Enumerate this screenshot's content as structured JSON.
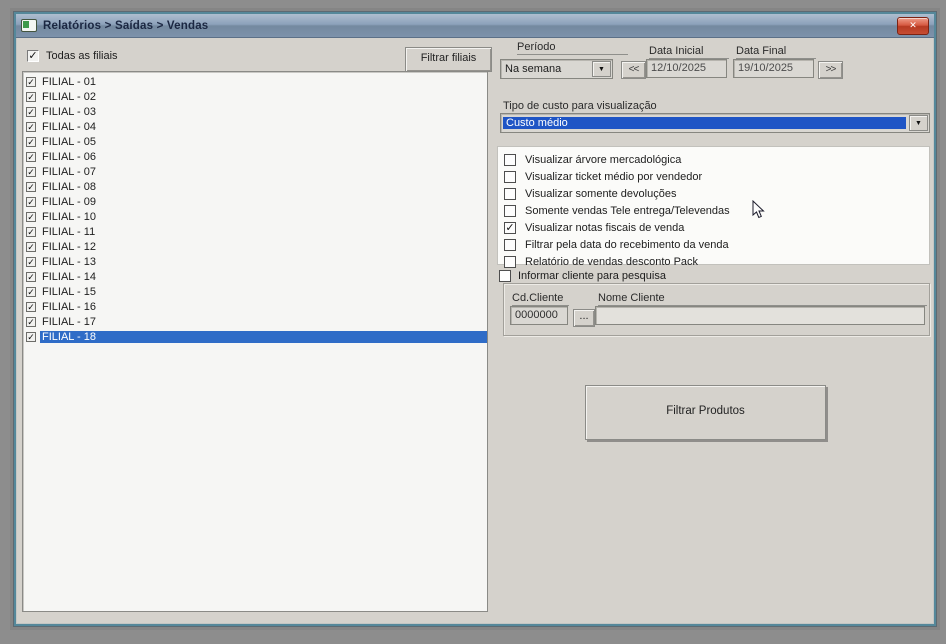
{
  "icons": {
    "check": "✓",
    "dropdown_arrow": "▼",
    "close": "✕"
  },
  "colors": {
    "selection_blue": "#2f6cc7",
    "combo_highlight_blue": "#1f55c5",
    "titlebar_blue": "#8ca1ba",
    "close_red": "#c64d33",
    "frame_teal": "#55889a",
    "window_gray": "#d5d2cc"
  },
  "window": {
    "title": "Relatórios > Saídas > Vendas"
  },
  "branches": {
    "all_label": "Todas as filiais",
    "all_checked": true,
    "filter_button": "Filtrar filiais",
    "selected_index": 17,
    "items": [
      {
        "label": "FILIAL - 01",
        "checked": true
      },
      {
        "label": "FILIAL - 02",
        "checked": true
      },
      {
        "label": "FILIAL - 03",
        "checked": true
      },
      {
        "label": "FILIAL - 04",
        "checked": true
      },
      {
        "label": "FILIAL - 05",
        "checked": true
      },
      {
        "label": "FILIAL - 06",
        "checked": true
      },
      {
        "label": "FILIAL - 07",
        "checked": true
      },
      {
        "label": "FILIAL - 08",
        "checked": true
      },
      {
        "label": "FILIAL - 09",
        "checked": true
      },
      {
        "label": "FILIAL - 10",
        "checked": true
      },
      {
        "label": "FILIAL - 11",
        "checked": true
      },
      {
        "label": "FILIAL - 12",
        "checked": true
      },
      {
        "label": "FILIAL - 13",
        "checked": true
      },
      {
        "label": "FILIAL - 14",
        "checked": true
      },
      {
        "label": "FILIAL - 15",
        "checked": true
      },
      {
        "label": "FILIAL - 16",
        "checked": true
      },
      {
        "label": "FILIAL - 17",
        "checked": true
      },
      {
        "label": "FILIAL - 18",
        "checked": true
      }
    ]
  },
  "period": {
    "label": "Período",
    "value": "Na semana",
    "prev_button": "<<",
    "next_button": ">>",
    "start": {
      "label": "Data Inicial",
      "value": "12/10/2025"
    },
    "end": {
      "label": "Data Final",
      "value": "19/10/2025"
    }
  },
  "cost_type": {
    "label": "Tipo de custo para visualização",
    "value": "Custo médio"
  },
  "options": [
    {
      "label": "Visualizar árvore mercadológica",
      "checked": false
    },
    {
      "label": "Visualizar ticket médio por vendedor",
      "checked": false
    },
    {
      "label": "Visualizar somente devoluções",
      "checked": false
    },
    {
      "label": "Somente vendas Tele entrega/Televendas",
      "checked": false
    },
    {
      "label": "Visualizar notas fiscais de venda",
      "checked": true
    },
    {
      "label": "Filtrar pela data do recebimento da venda",
      "checked": false
    },
    {
      "label": "Relatório de vendas desconto Pack",
      "checked": false
    }
  ],
  "client_search": {
    "toggle_label": "Informar cliente para pesquisa",
    "toggle_checked": false,
    "code": {
      "label": "Cd.Cliente",
      "value": "0000000"
    },
    "lookup_button": "...",
    "name": {
      "label": "Nome Cliente",
      "value": ""
    }
  },
  "filter_products_button": "Filtrar Produtos"
}
